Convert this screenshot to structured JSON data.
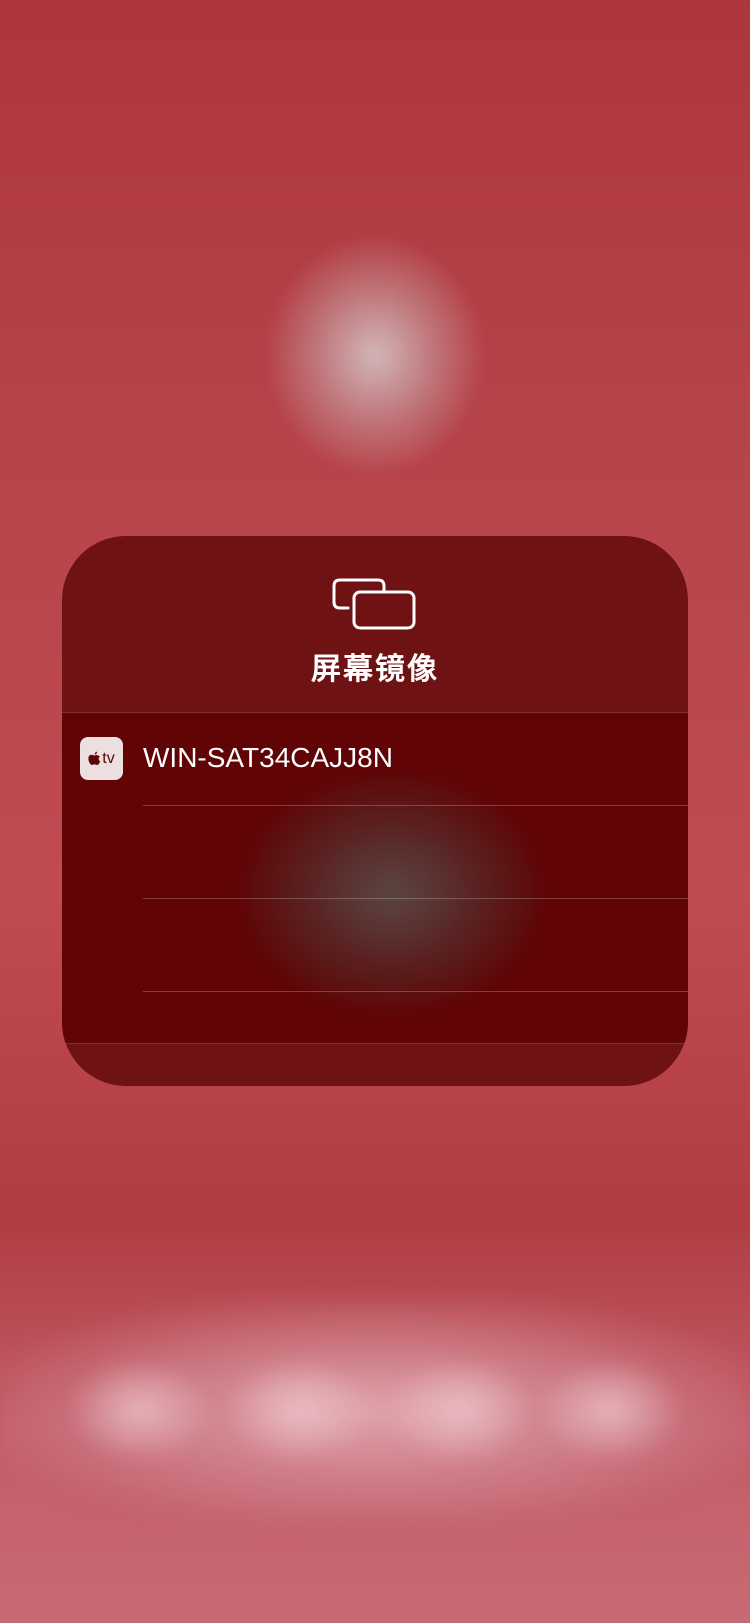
{
  "screen_mirroring": {
    "title": "屏幕镜像",
    "icon": "screen-mirroring-icon",
    "devices": [
      {
        "icon_text": "tv",
        "icon": "apple-tv-icon",
        "name": "WIN-SAT34CAJJ8N"
      },
      {
        "name": ""
      },
      {
        "name": ""
      }
    ]
  },
  "colors": {
    "background": "#b0383d",
    "panel": "#6e1214",
    "list": "#600406",
    "text": "#ffffff"
  }
}
